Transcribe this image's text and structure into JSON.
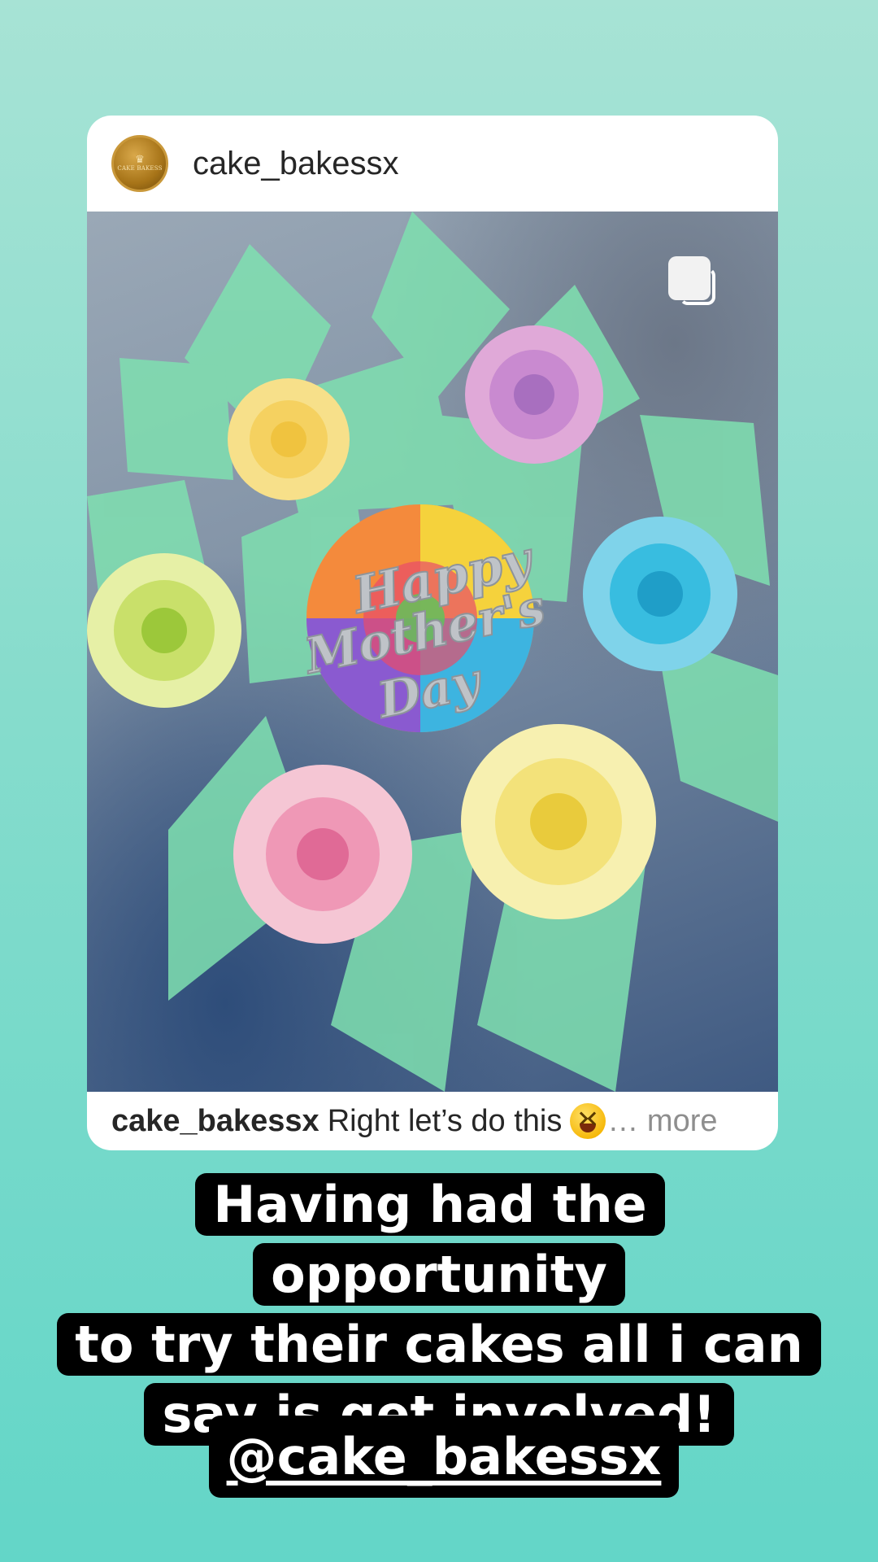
{
  "post": {
    "username": "cake_bakessx",
    "avatar_label": "CAKE BAKESS",
    "avatar_icon": "crown-icon",
    "caption_user": "cake_bakessx",
    "caption_text": "Right let’s do this",
    "caption_emoji": "grinning-squinting-face-emoji",
    "caption_more": "… more",
    "photo_topper_text": "Happy Mother's Day",
    "multi_post_icon": "carousel-icon"
  },
  "story": {
    "text_lines": [
      "Having had the opportunity",
      "to try their cakes all i can",
      "say is get involved!"
    ],
    "mention": "@cake_bakessx"
  },
  "colors": {
    "background_top": "#a7e3d5",
    "background_bottom": "#63d6c8",
    "card": "#ffffff",
    "text_box": "#000000",
    "caption_more": "#8e8e8e"
  }
}
